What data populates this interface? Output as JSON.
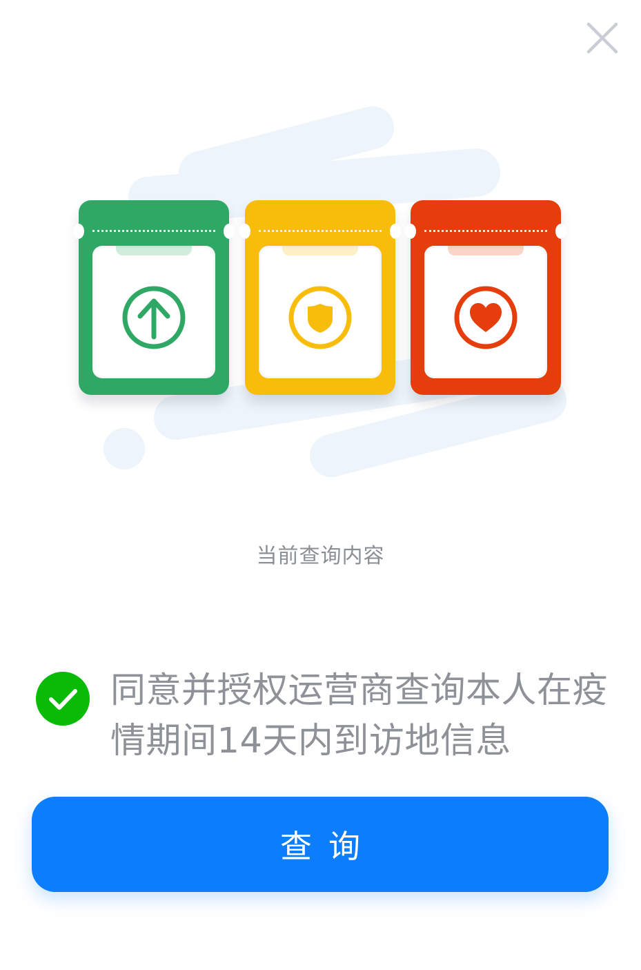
{
  "dialog": {
    "close_icon": "close-icon"
  },
  "hero": {
    "cards": [
      {
        "name": "green-code-card",
        "color": "#2fa866",
        "icon": "arrow-up-icon"
      },
      {
        "name": "yellow-code-card",
        "color": "#f8bc0a",
        "icon": "shield-icon"
      },
      {
        "name": "red-code-card",
        "color": "#e53d0b",
        "icon": "heart-icon"
      }
    ]
  },
  "caption": "当前查询内容",
  "agreement": {
    "checked": true,
    "check_color": "#09bb07",
    "text": "同意并授权运营商查询本人在疫情期间14天内到访地信息"
  },
  "query_button": {
    "label": "查询",
    "color": "#0c7efb"
  }
}
